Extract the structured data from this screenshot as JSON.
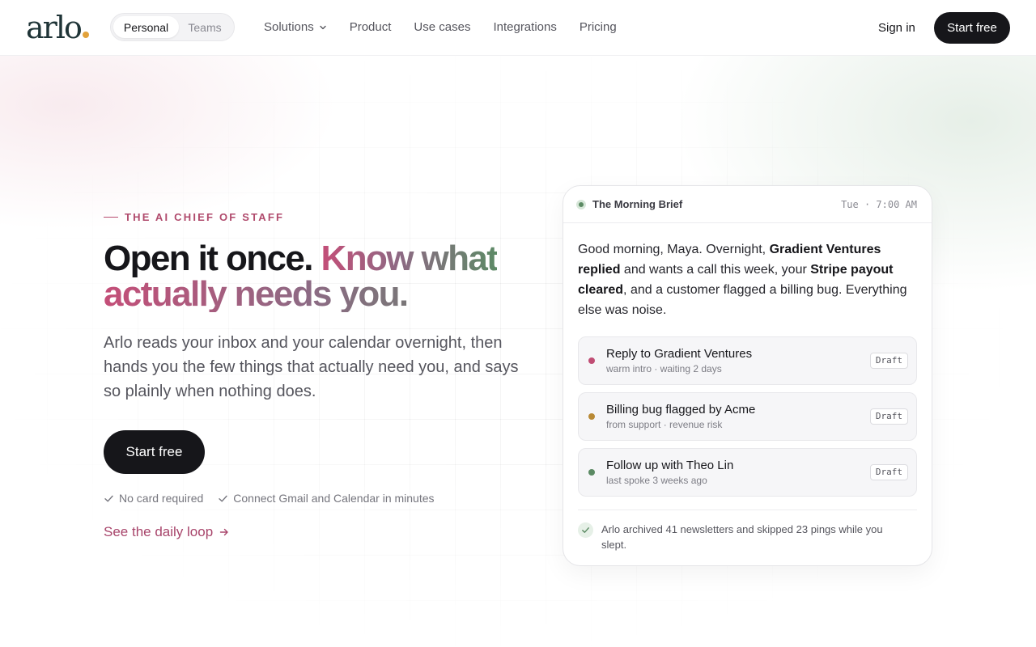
{
  "header": {
    "logo_text": "arlo",
    "segmented": {
      "options": [
        "Personal",
        "Teams"
      ],
      "selected": "Personal"
    },
    "nav": [
      {
        "label": "Solutions",
        "has_dropdown": true
      },
      {
        "label": "Product"
      },
      {
        "label": "Use cases"
      },
      {
        "label": "Integrations"
      },
      {
        "label": "Pricing"
      }
    ],
    "sign_in": "Sign in",
    "cta": "Start free"
  },
  "hero": {
    "eyebrow": "THE AI CHIEF OF STAFF",
    "headline_dark": "Open it once.",
    "headline_accent_1": "Know what",
    "headline_accent_2": "actually needs you.",
    "lede": "Arlo reads your inbox and your calendar overnight, then hands you the few things that actually need you, and says so plainly when nothing does.",
    "cta": "Start free",
    "checks": [
      "No card required",
      "Connect Gmail and Calendar in minutes"
    ],
    "link": "See the daily loop"
  },
  "brief": {
    "title": "The Morning Brief",
    "time": "Tue · 7:00 AM",
    "message": {
      "p1": "Good morning, Maya. Overnight, ",
      "b1": "Gradient Ventures replied",
      "p2": " and wants a call this week, your ",
      "b2": "Stripe payout cleared",
      "p3": ", and a customer flagged a billing bug. Everything else was noise."
    },
    "tasks": [
      {
        "title": "Reply to Gradient Ventures",
        "sub": "warm intro · waiting 2 days",
        "badge": "Draft",
        "color": "#c04d74"
      },
      {
        "title": "Billing bug flagged by Acme",
        "sub": "from support · revenue risk",
        "badge": "Draft",
        "color": "#b98a36"
      },
      {
        "title": "Follow up with Theo Lin",
        "sub": "last spoke 3 weeks ago",
        "badge": "Draft",
        "color": "#5b8a63"
      }
    ],
    "footer": "Arlo archived 41 newsletters and skipped 23 pings while you slept."
  },
  "colors": {
    "ink": "#16161a",
    "accent_rose": "#c44e78",
    "accent_green": "#5d8a66",
    "logo_dot": "#e2a23b"
  },
  "icons": [
    "chevron-down-icon",
    "check-icon",
    "arrow-right-icon",
    "status-dot-icon"
  ]
}
